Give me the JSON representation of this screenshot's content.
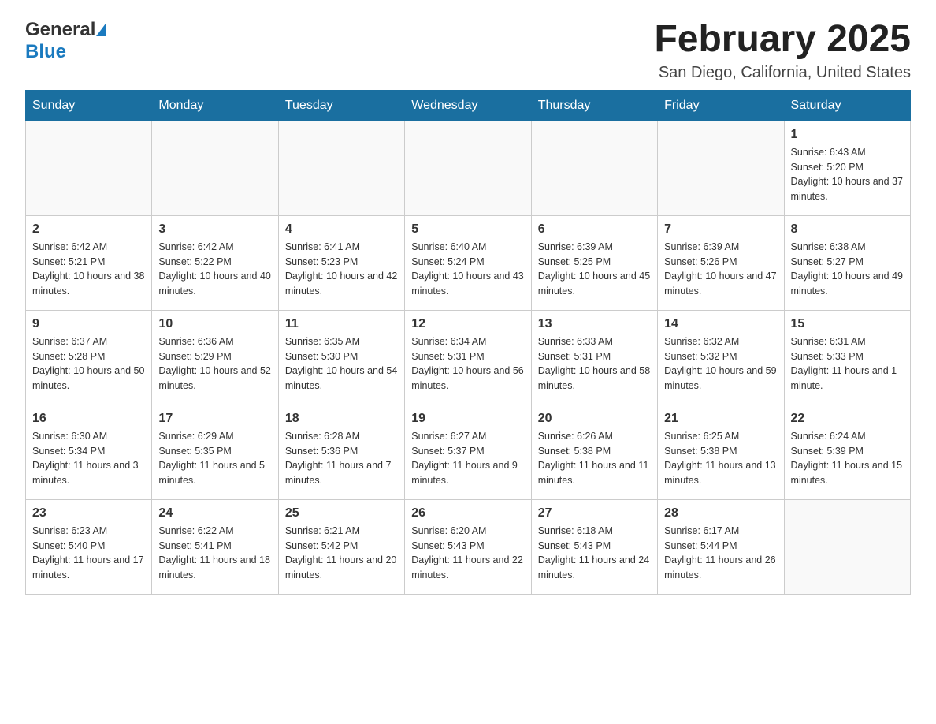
{
  "header": {
    "logo_general": "General",
    "logo_blue": "Blue",
    "month_title": "February 2025",
    "location": "San Diego, California, United States"
  },
  "days_of_week": [
    "Sunday",
    "Monday",
    "Tuesday",
    "Wednesday",
    "Thursday",
    "Friday",
    "Saturday"
  ],
  "weeks": [
    [
      {
        "day": "",
        "sunrise": "",
        "sunset": "",
        "daylight": ""
      },
      {
        "day": "",
        "sunrise": "",
        "sunset": "",
        "daylight": ""
      },
      {
        "day": "",
        "sunrise": "",
        "sunset": "",
        "daylight": ""
      },
      {
        "day": "",
        "sunrise": "",
        "sunset": "",
        "daylight": ""
      },
      {
        "day": "",
        "sunrise": "",
        "sunset": "",
        "daylight": ""
      },
      {
        "day": "",
        "sunrise": "",
        "sunset": "",
        "daylight": ""
      },
      {
        "day": "1",
        "sunrise": "Sunrise: 6:43 AM",
        "sunset": "Sunset: 5:20 PM",
        "daylight": "Daylight: 10 hours and 37 minutes."
      }
    ],
    [
      {
        "day": "2",
        "sunrise": "Sunrise: 6:42 AM",
        "sunset": "Sunset: 5:21 PM",
        "daylight": "Daylight: 10 hours and 38 minutes."
      },
      {
        "day": "3",
        "sunrise": "Sunrise: 6:42 AM",
        "sunset": "Sunset: 5:22 PM",
        "daylight": "Daylight: 10 hours and 40 minutes."
      },
      {
        "day": "4",
        "sunrise": "Sunrise: 6:41 AM",
        "sunset": "Sunset: 5:23 PM",
        "daylight": "Daylight: 10 hours and 42 minutes."
      },
      {
        "day": "5",
        "sunrise": "Sunrise: 6:40 AM",
        "sunset": "Sunset: 5:24 PM",
        "daylight": "Daylight: 10 hours and 43 minutes."
      },
      {
        "day": "6",
        "sunrise": "Sunrise: 6:39 AM",
        "sunset": "Sunset: 5:25 PM",
        "daylight": "Daylight: 10 hours and 45 minutes."
      },
      {
        "day": "7",
        "sunrise": "Sunrise: 6:39 AM",
        "sunset": "Sunset: 5:26 PM",
        "daylight": "Daylight: 10 hours and 47 minutes."
      },
      {
        "day": "8",
        "sunrise": "Sunrise: 6:38 AM",
        "sunset": "Sunset: 5:27 PM",
        "daylight": "Daylight: 10 hours and 49 minutes."
      }
    ],
    [
      {
        "day": "9",
        "sunrise": "Sunrise: 6:37 AM",
        "sunset": "Sunset: 5:28 PM",
        "daylight": "Daylight: 10 hours and 50 minutes."
      },
      {
        "day": "10",
        "sunrise": "Sunrise: 6:36 AM",
        "sunset": "Sunset: 5:29 PM",
        "daylight": "Daylight: 10 hours and 52 minutes."
      },
      {
        "day": "11",
        "sunrise": "Sunrise: 6:35 AM",
        "sunset": "Sunset: 5:30 PM",
        "daylight": "Daylight: 10 hours and 54 minutes."
      },
      {
        "day": "12",
        "sunrise": "Sunrise: 6:34 AM",
        "sunset": "Sunset: 5:31 PM",
        "daylight": "Daylight: 10 hours and 56 minutes."
      },
      {
        "day": "13",
        "sunrise": "Sunrise: 6:33 AM",
        "sunset": "Sunset: 5:31 PM",
        "daylight": "Daylight: 10 hours and 58 minutes."
      },
      {
        "day": "14",
        "sunrise": "Sunrise: 6:32 AM",
        "sunset": "Sunset: 5:32 PM",
        "daylight": "Daylight: 10 hours and 59 minutes."
      },
      {
        "day": "15",
        "sunrise": "Sunrise: 6:31 AM",
        "sunset": "Sunset: 5:33 PM",
        "daylight": "Daylight: 11 hours and 1 minute."
      }
    ],
    [
      {
        "day": "16",
        "sunrise": "Sunrise: 6:30 AM",
        "sunset": "Sunset: 5:34 PM",
        "daylight": "Daylight: 11 hours and 3 minutes."
      },
      {
        "day": "17",
        "sunrise": "Sunrise: 6:29 AM",
        "sunset": "Sunset: 5:35 PM",
        "daylight": "Daylight: 11 hours and 5 minutes."
      },
      {
        "day": "18",
        "sunrise": "Sunrise: 6:28 AM",
        "sunset": "Sunset: 5:36 PM",
        "daylight": "Daylight: 11 hours and 7 minutes."
      },
      {
        "day": "19",
        "sunrise": "Sunrise: 6:27 AM",
        "sunset": "Sunset: 5:37 PM",
        "daylight": "Daylight: 11 hours and 9 minutes."
      },
      {
        "day": "20",
        "sunrise": "Sunrise: 6:26 AM",
        "sunset": "Sunset: 5:38 PM",
        "daylight": "Daylight: 11 hours and 11 minutes."
      },
      {
        "day": "21",
        "sunrise": "Sunrise: 6:25 AM",
        "sunset": "Sunset: 5:38 PM",
        "daylight": "Daylight: 11 hours and 13 minutes."
      },
      {
        "day": "22",
        "sunrise": "Sunrise: 6:24 AM",
        "sunset": "Sunset: 5:39 PM",
        "daylight": "Daylight: 11 hours and 15 minutes."
      }
    ],
    [
      {
        "day": "23",
        "sunrise": "Sunrise: 6:23 AM",
        "sunset": "Sunset: 5:40 PM",
        "daylight": "Daylight: 11 hours and 17 minutes."
      },
      {
        "day": "24",
        "sunrise": "Sunrise: 6:22 AM",
        "sunset": "Sunset: 5:41 PM",
        "daylight": "Daylight: 11 hours and 18 minutes."
      },
      {
        "day": "25",
        "sunrise": "Sunrise: 6:21 AM",
        "sunset": "Sunset: 5:42 PM",
        "daylight": "Daylight: 11 hours and 20 minutes."
      },
      {
        "day": "26",
        "sunrise": "Sunrise: 6:20 AM",
        "sunset": "Sunset: 5:43 PM",
        "daylight": "Daylight: 11 hours and 22 minutes."
      },
      {
        "day": "27",
        "sunrise": "Sunrise: 6:18 AM",
        "sunset": "Sunset: 5:43 PM",
        "daylight": "Daylight: 11 hours and 24 minutes."
      },
      {
        "day": "28",
        "sunrise": "Sunrise: 6:17 AM",
        "sunset": "Sunset: 5:44 PM",
        "daylight": "Daylight: 11 hours and 26 minutes."
      },
      {
        "day": "",
        "sunrise": "",
        "sunset": "",
        "daylight": ""
      }
    ]
  ]
}
